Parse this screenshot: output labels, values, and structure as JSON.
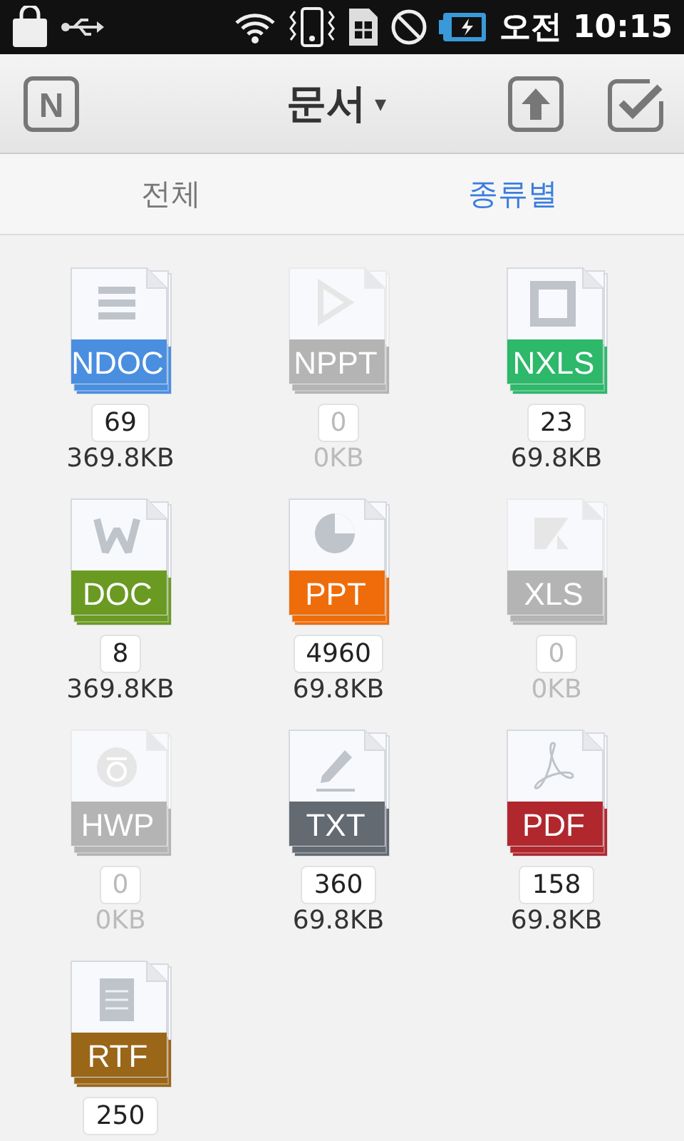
{
  "status_bar": {
    "time": "오전 10:15"
  },
  "app_bar": {
    "logo": "N",
    "title": "문서",
    "title_caret": "▾"
  },
  "tabs": [
    {
      "label": "전체",
      "selected": false
    },
    {
      "label": "종류별",
      "selected": true
    }
  ],
  "file_types": [
    {
      "label": "NDOC",
      "kind": "lines",
      "count": "69",
      "size": "369.8KB",
      "disabled": false,
      "color": "#4a8ee0"
    },
    {
      "label": "NPPT",
      "kind": "play",
      "count": "0",
      "size": "0KB",
      "disabled": true,
      "color": "#b4b4b4"
    },
    {
      "label": "NXLS",
      "kind": "square",
      "count": "23",
      "size": "69.8KB",
      "disabled": false,
      "color": "#2db86a"
    },
    {
      "label": "DOC",
      "kind": "w",
      "count": "8",
      "size": "369.8KB",
      "disabled": false,
      "color": "#6a9a22"
    },
    {
      "label": "PPT",
      "kind": "pie",
      "count": "4960",
      "size": "69.8KB",
      "disabled": false,
      "color": "#ee6d0a"
    },
    {
      "label": "XLS",
      "kind": "x",
      "count": "0",
      "size": "0KB",
      "disabled": true,
      "color": "#b4b4b4"
    },
    {
      "label": "HWP",
      "kind": "ring",
      "count": "0",
      "size": "0KB",
      "disabled": true,
      "color": "#b4b4b4"
    },
    {
      "label": "TXT",
      "kind": "pencil",
      "count": "360",
      "size": "69.8KB",
      "disabled": false,
      "color": "#636a72"
    },
    {
      "label": "PDF",
      "kind": "acrobat",
      "count": "158",
      "size": "69.8KB",
      "disabled": false,
      "color": "#b0282e"
    },
    {
      "label": "RTF",
      "kind": "page",
      "count": "250",
      "disabled": false,
      "color": "#9a6618"
    }
  ]
}
